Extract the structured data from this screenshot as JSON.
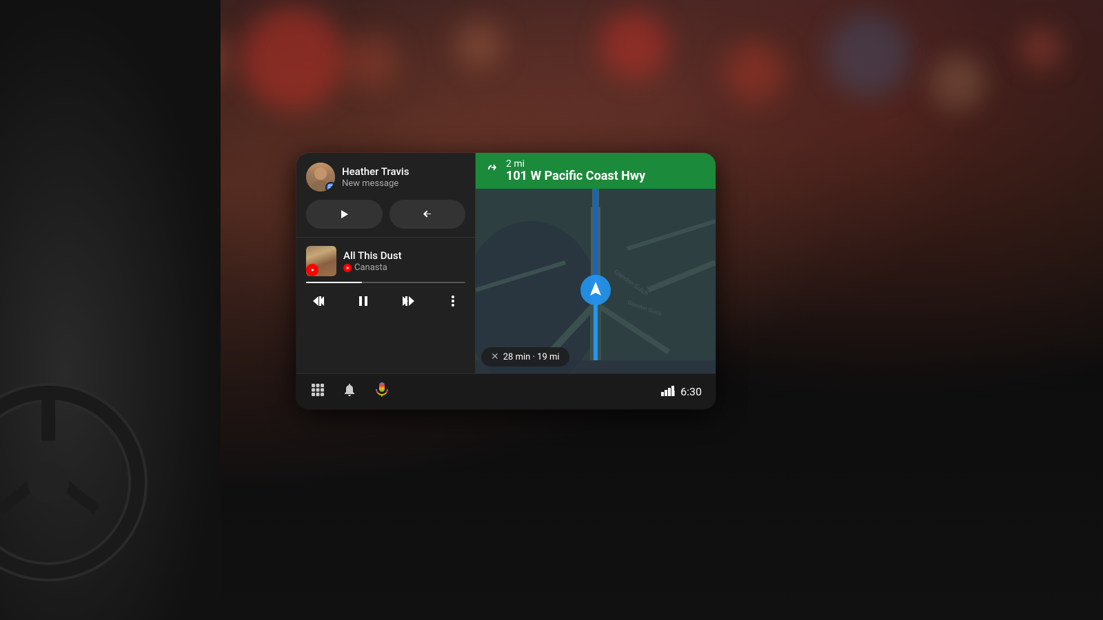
{
  "background": {
    "description": "Car dashboard interior with bokeh lights"
  },
  "android_auto": {
    "message": {
      "sender": "Heather Travis",
      "subtitle": "New message",
      "play_label": "▶",
      "reply_label": "↩"
    },
    "music": {
      "song_title": "All This Dust",
      "artist": "Canasta",
      "app_icon": "youtube-music"
    },
    "controls": {
      "prev": "⏮",
      "pause": "⏸",
      "next": "⏭",
      "more": "⋮"
    },
    "navigation": {
      "distance": "2 mi",
      "street": "101 W Pacific Coast Hwy",
      "eta": "28 min · 19 mi"
    },
    "bottom_bar": {
      "time": "6:30"
    }
  }
}
